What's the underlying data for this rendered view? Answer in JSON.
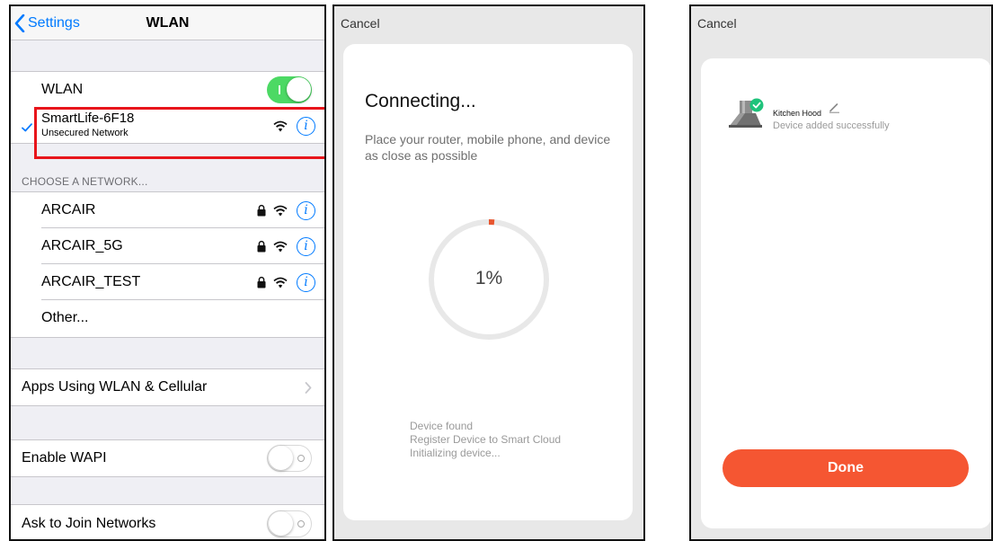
{
  "wlan_settings": {
    "nav": {
      "back_label": "Settings",
      "title": "WLAN"
    },
    "wlan_row": {
      "label": "WLAN",
      "toggle": "on"
    },
    "connected_network": {
      "name": "SmartLife-6F18",
      "subtitle": "Unsecured Network",
      "icons": [
        "checkmark-icon",
        "wifi-icon",
        "info-icon"
      ]
    },
    "section_header": "CHOOSE A NETWORK...",
    "networks": [
      {
        "name": "ARCAIR",
        "secured": true
      },
      {
        "name": "ARCAIR_5G",
        "secured": true
      },
      {
        "name": "ARCAIR_TEST",
        "secured": true
      }
    ],
    "other_label": "Other...",
    "apps_row": {
      "label": "Apps Using WLAN & Cellular"
    },
    "wapi_row": {
      "label": "Enable WAPI",
      "toggle": "off"
    },
    "ask_row": {
      "label": "Ask to Join Networks",
      "toggle": "off"
    },
    "info_glyph": "i",
    "colors": {
      "accent": "#007aff",
      "toggle_on": "#4cd964",
      "highlight": "#e8151b"
    }
  },
  "connecting": {
    "cancel_label": "Cancel",
    "title": "Connecting...",
    "description": "Place your router, mobile phone, and device as close as possible",
    "progress_percent": 1,
    "progress_label": "1%",
    "steps": [
      "Device found",
      "Register Device to Smart Cloud",
      "Initializing device..."
    ],
    "colors": {
      "progress": "#e8562f",
      "track": "#e8e8e8"
    }
  },
  "done_screen": {
    "cancel_label": "Cancel",
    "device": {
      "name": "Kitchen Hood",
      "status": "Device added successfully",
      "icons": [
        "range-hood-icon",
        "success-badge-icon",
        "edit-icon"
      ]
    },
    "done_label": "Done",
    "colors": {
      "button": "#f55632",
      "badge": "#1fc37b"
    }
  }
}
